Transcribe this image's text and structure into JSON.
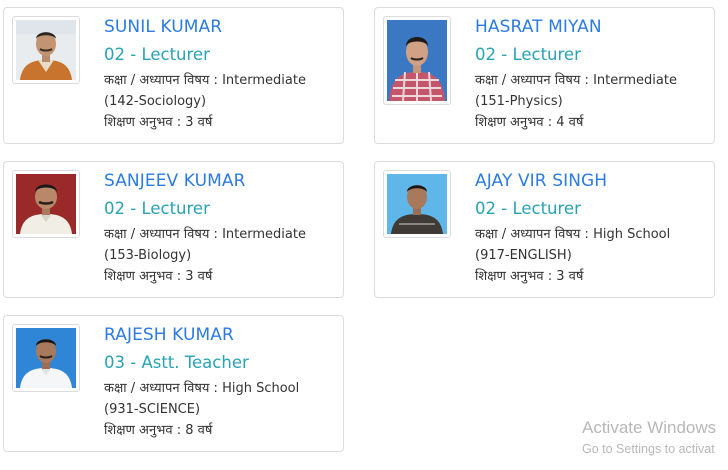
{
  "teachers": [
    {
      "name": "SUNIL KUMAR",
      "post": "02 - Lecturer",
      "class_subject_label": "कक्षा / अध्यापन विषय :",
      "class": "Intermediate",
      "subject": "(142-Sociology)",
      "experience_label": "शिक्षण अनुभव :",
      "experience": "3 वर्ष"
    },
    {
      "name": "HASRAT MIYAN",
      "post": "02 - Lecturer",
      "class_subject_label": "कक्षा / अध्यापन विषय :",
      "class": "Intermediate",
      "subject": "(151-Physics)",
      "experience_label": "शिक्षण अनुभव :",
      "experience": "4 वर्ष"
    },
    {
      "name": "SANJEEV KUMAR",
      "post": "02 - Lecturer",
      "class_subject_label": "कक्षा / अध्यापन विषय :",
      "class": "Intermediate",
      "subject": "(153-Biology)",
      "experience_label": "शिक्षण अनुभव :",
      "experience": "3 वर्ष"
    },
    {
      "name": "AJAY VIR SINGH",
      "post": "02 - Lecturer",
      "class_subject_label": "कक्षा / अध्यापन विषय :",
      "class": "High School",
      "subject": "(917-ENGLISH)",
      "experience_label": "शिक्षण अनुभव :",
      "experience": "3 वर्ष"
    },
    {
      "name": "RAJESH KUMAR",
      "post": "03 - Astt. Teacher",
      "class_subject_label": "कक्षा / अध्यापन विषय :",
      "class": "High School",
      "subject": "(931-SCIENCE)",
      "experience_label": "शिक्षण अनुभव :",
      "experience": "8 वर्ष"
    }
  ],
  "watermark": {
    "title": "Activate Windows",
    "subtitle": "Go to Settings to activat"
  },
  "colors": {
    "name": "#2c7be5",
    "post": "#28a3b4",
    "text": "#333333",
    "border": "#dcdcdc"
  }
}
